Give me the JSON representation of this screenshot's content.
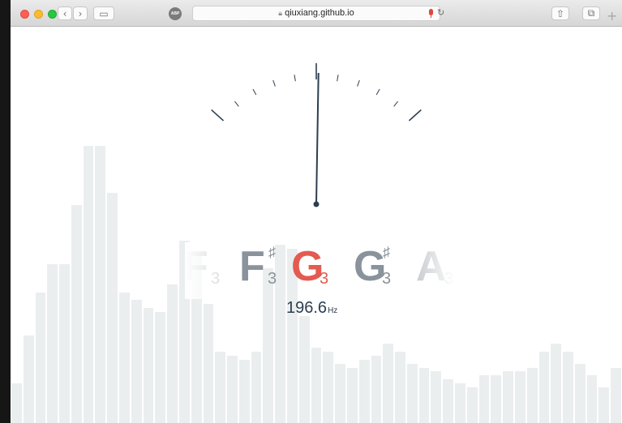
{
  "browser": {
    "url": "qiuxiang.github.io",
    "back_glyph": "‹",
    "forward_glyph": "›",
    "sidebar_glyph": "▭",
    "extension_label": "ABP",
    "reload_glyph": "↻",
    "share_glyph": "⇧",
    "tabs_glyph": "⧉",
    "new_tab_glyph": "+",
    "icons": [
      "back-icon",
      "forward-icon",
      "sidebar-icon",
      "lock-icon",
      "microphone-icon",
      "reload-icon",
      "share-icon",
      "tabs-icon",
      "plus-icon"
    ]
  },
  "tuner": {
    "frequency": "196.6",
    "frequency_unit": "Hz",
    "needle_deflection_fraction": 0.02,
    "current_note_index": 2,
    "notes": [
      {
        "name": "F",
        "sharp": "",
        "octave": "3"
      },
      {
        "name": "F",
        "sharp": "♯",
        "octave": "3"
      },
      {
        "name": "G",
        "sharp": "",
        "octave": "3"
      },
      {
        "name": "G",
        "sharp": "♯",
        "octave": "3"
      },
      {
        "name": "A",
        "sharp": "",
        "octave": "3"
      }
    ],
    "spectrum_levels": [
      0.1,
      0.22,
      0.33,
      0.4,
      0.4,
      0.55,
      0.7,
      0.7,
      0.58,
      0.33,
      0.31,
      0.29,
      0.28,
      0.35,
      0.46,
      0.43,
      0.3,
      0.18,
      0.17,
      0.16,
      0.18,
      0.39,
      0.45,
      0.44,
      0.27,
      0.19,
      0.18,
      0.15,
      0.14,
      0.16,
      0.17,
      0.2,
      0.18,
      0.15,
      0.14,
      0.13,
      0.11,
      0.1,
      0.09,
      0.12,
      0.12,
      0.13,
      0.13,
      0.14,
      0.18,
      0.2,
      0.18,
      0.15,
      0.12,
      0.09,
      0.14
    ],
    "colors": {
      "active": "#e35b51",
      "inactive": "#8a929c",
      "needle": "#2c3e50",
      "spectrum": "#ebeeef"
    }
  }
}
